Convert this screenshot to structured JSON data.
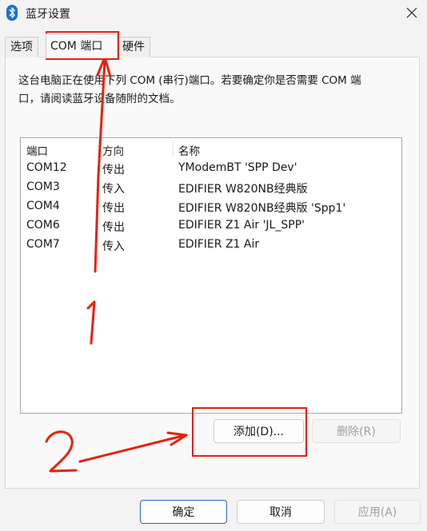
{
  "window": {
    "title": "蓝牙设置"
  },
  "tabs": [
    {
      "label": "选项"
    },
    {
      "label": "COM 端口"
    },
    {
      "label": "硬件"
    }
  ],
  "description": {
    "line1": "这台电脑正在使用下列 COM (串行)端口。若要确定你是否需要 COM 端",
    "line2": "口，请阅读蓝牙设备随附的文档。"
  },
  "table": {
    "columns": [
      "端口",
      "方向",
      "名称"
    ],
    "rows": [
      {
        "port": "COM12",
        "direction": "传出",
        "name": "YModemBT 'SPP Dev'"
      },
      {
        "port": "COM3",
        "direction": "传入",
        "name": "EDIFIER W820NB经典版"
      },
      {
        "port": "COM4",
        "direction": "传出",
        "name": "EDIFIER W820NB经典版 'Spp1'"
      },
      {
        "port": "COM6",
        "direction": "传出",
        "name": "EDIFIER Z1 Air 'JL_SPP'"
      },
      {
        "port": "COM7",
        "direction": "传入",
        "name": "EDIFIER Z1 Air"
      }
    ]
  },
  "panel_buttons": {
    "add": "添加(D)...",
    "remove": "删除(R)"
  },
  "footer_buttons": {
    "ok": "确定",
    "cancel": "取消",
    "apply": "应用(A)"
  },
  "annotations": {
    "note1": "1",
    "note2": "2",
    "color": "#e8200f"
  },
  "colors": {
    "bluetooth": "#1673d6",
    "primary_border": "#2a63b8"
  }
}
